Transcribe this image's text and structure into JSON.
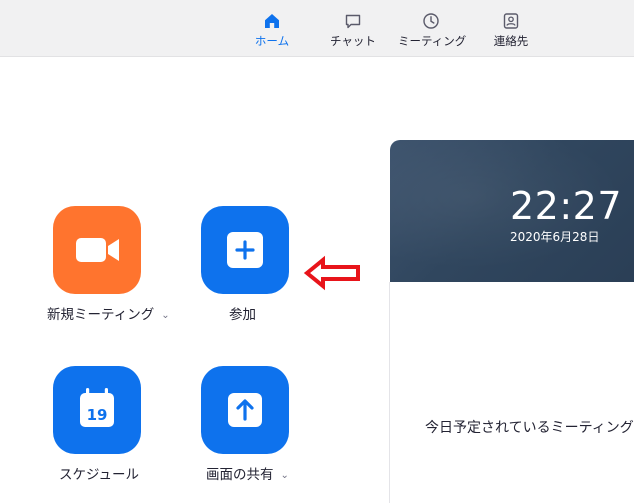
{
  "nav": {
    "tabs": [
      {
        "label": "ホーム",
        "icon": "home-icon",
        "active": true
      },
      {
        "label": "チャット",
        "icon": "chat-icon",
        "active": false
      },
      {
        "label": "ミーティング",
        "icon": "clock-icon",
        "active": false
      },
      {
        "label": "連絡先",
        "icon": "contact-icon",
        "active": false
      }
    ]
  },
  "actions": {
    "new_meeting": {
      "label": "新規ミーティング",
      "icon": "video-camera-icon",
      "has_dropdown": true
    },
    "join": {
      "label": "参加",
      "icon": "plus-icon"
    },
    "schedule": {
      "label": "スケジュール",
      "icon": "calendar-icon",
      "icon_text": "19"
    },
    "share_screen": {
      "label": "画面の共有",
      "icon": "share-arrow-icon",
      "has_dropdown": true
    }
  },
  "calendar": {
    "time": "22:27",
    "date": "2020年6月28日",
    "empty_message": "今日予定されているミーティングは"
  },
  "annotation": {
    "type": "red-left-arrow",
    "color": "#e8141a"
  },
  "colors": {
    "accent": "#0e72ed",
    "orange": "#ff742e",
    "text": "#232333"
  }
}
